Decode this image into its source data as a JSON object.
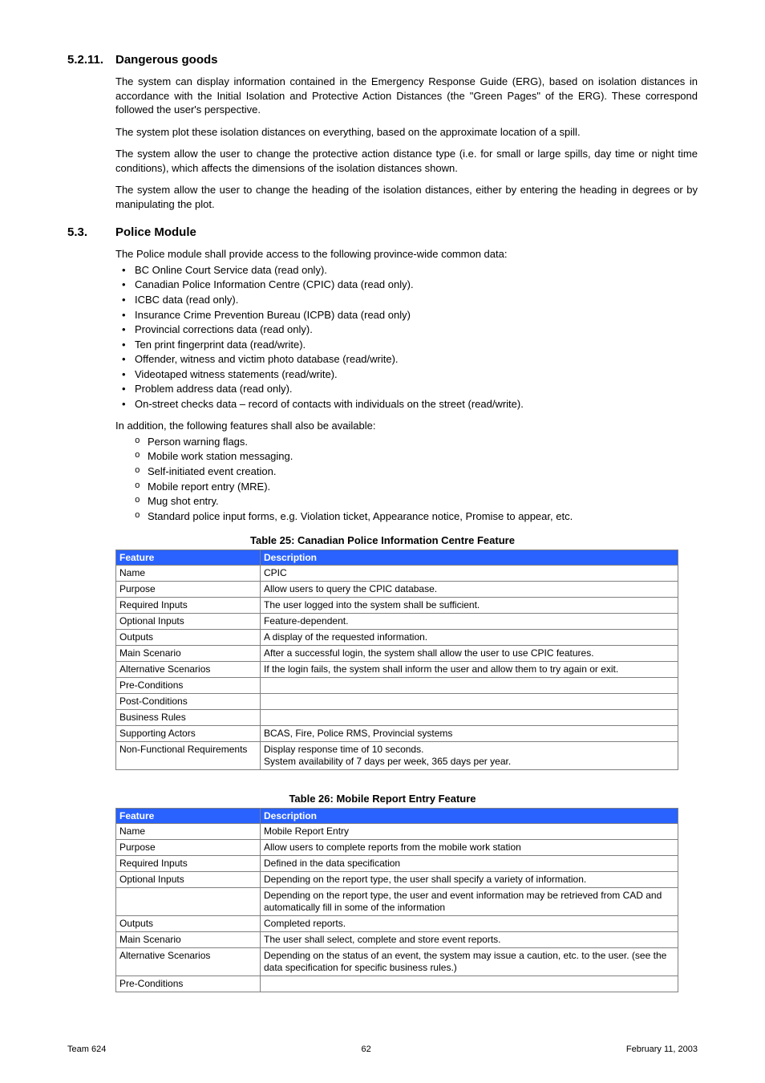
{
  "sections": [
    {
      "num": "5.2.11.",
      "title": "Dangerous goods",
      "paras": [
        "The system can display information contained in the Emergency Response Guide (ERG), based on isolation distances in accordance with the Initial Isolation and Protective Action Distances (the \"Green Pages\" of the ERG). These correspond followed the user's perspective.",
        "The system plot these isolation distances on everything, based on the approximate location of a spill.",
        "The system allow the user to change the protective action distance type (i.e. for small or large spills, day time or night time conditions), which affects the dimensions of the isolation distances shown.",
        "The system allow the user to change the heading of the isolation distances, either by entering the heading in degrees or by manipulating the plot."
      ]
    }
  ],
  "section_module": {
    "num": "5.3.",
    "title": "Police Module",
    "para": "The Police module shall provide access to the following province-wide common data:",
    "bullets": [
      "BC Online Court Service data (read only).",
      "Canadian Police Information Centre (CPIC) data (read only).",
      "ICBC data (read only).",
      "Insurance Crime Prevention Bureau (ICPB) data (read only)",
      "Provincial corrections data (read only).",
      "Ten print fingerprint data (read/write).",
      "Offender, witness and victim photo database (read/write).",
      "Videotaped witness statements (read/write).",
      "Problem address data (read only).",
      "On-street checks data – record of contacts with individuals on the street (read/write)."
    ],
    "para2": "In addition, the following features shall also be available:",
    "sub_bullets": [
      "Person warning flags.",
      "Mobile work station messaging.",
      "Self-initiated event creation.",
      "Mobile report entry (MRE).",
      "Mug shot entry.",
      "Standard police input forms, e.g. Violation ticket, Appearance notice, Promise to appear, etc."
    ]
  },
  "tables": [
    {
      "caption": "Table 25: Canadian Police Information Centre Feature",
      "headers": [
        "Feature",
        "Description"
      ],
      "rows": [
        [
          "Name",
          "CPIC"
        ],
        [
          "Purpose",
          "Allow users to query the CPIC database."
        ],
        [
          "Required Inputs",
          "The user logged into the system shall be sufficient."
        ],
        [
          "Optional Inputs",
          "Feature-dependent."
        ],
        [
          "Outputs",
          "A display of the requested information."
        ],
        [
          "Main Scenario",
          "After a successful login, the system shall allow the user to use CPIC features."
        ],
        [
          "Alternative Scenarios",
          "If the login fails, the system shall inform the user and allow them to try again or exit."
        ],
        [
          "Pre-Conditions",
          ""
        ],
        [
          "Post-Conditions",
          ""
        ],
        [
          "Business Rules",
          ""
        ],
        [
          "Supporting Actors",
          "BCAS, Fire, Police RMS, Provincial systems"
        ],
        [
          "Non-Functional Requirements",
          "Display response time of 10 seconds.\nSystem availability of 7 days per week, 365 days per year."
        ]
      ]
    },
    {
      "caption": "Table 26: Mobile Report Entry Feature",
      "headers": [
        "Feature",
        "Description"
      ],
      "rows": [
        [
          "Name",
          "Mobile Report Entry"
        ],
        [
          "Purpose",
          "Allow users to complete reports from the mobile work station"
        ],
        [
          "Required Inputs",
          "Defined in the data specification"
        ],
        [
          "Optional Inputs",
          "Depending on the report type, the user shall specify a variety of information."
        ],
        [
          "",
          "Depending on the report type, the user and event information may be retrieved from CAD and automatically fill in some of the information"
        ],
        [
          "Outputs",
          "Completed reports."
        ],
        [
          "Main Scenario",
          "The user shall select, complete and store event reports."
        ],
        [
          "Alternative Scenarios",
          "Depending on the status of an event, the system may issue a caution, etc. to the user. (see the data specification for specific business rules.)"
        ],
        [
          "Pre-Conditions",
          ""
        ]
      ]
    }
  ],
  "footer": {
    "left": "Team 624",
    "center": "62",
    "right": "February 11, 2003"
  }
}
